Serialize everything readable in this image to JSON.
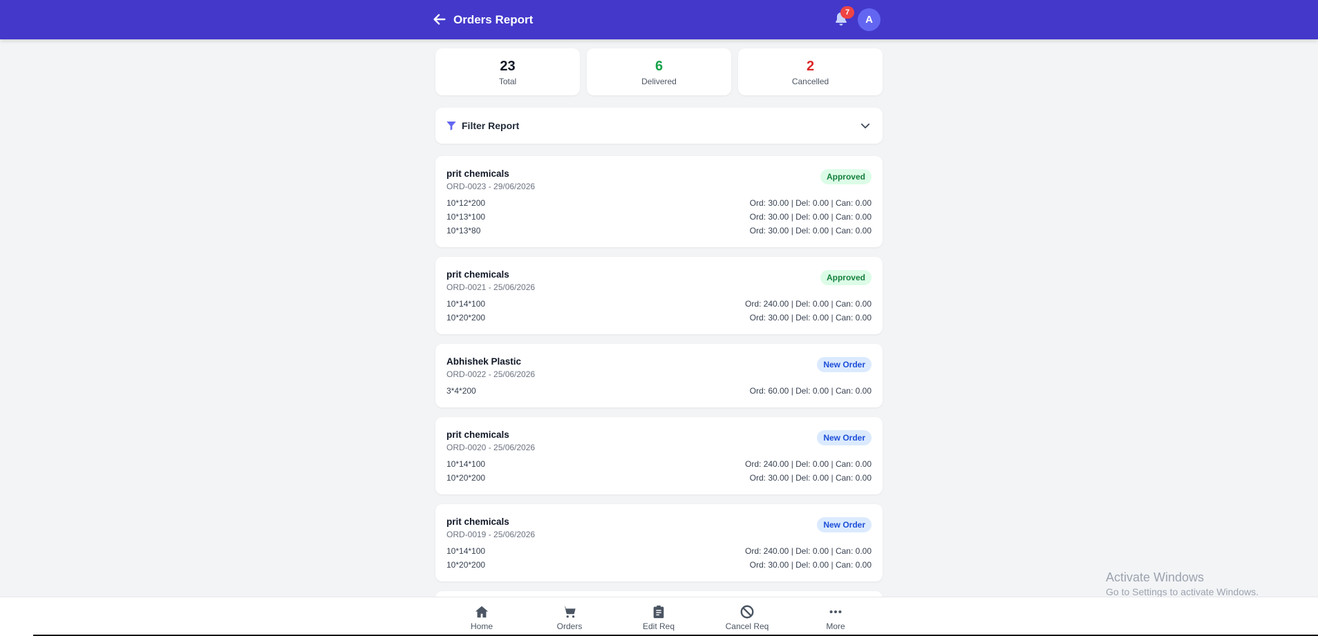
{
  "header": {
    "title": "Orders Report",
    "notification_count": "7",
    "avatar_initial": "A"
  },
  "stats": [
    {
      "value": "23",
      "label": "Total",
      "color": "#111827"
    },
    {
      "value": "6",
      "label": "Delivered",
      "color": "#16a34a"
    },
    {
      "value": "2",
      "label": "Cancelled",
      "color": "#dc2626"
    }
  ],
  "filter": {
    "label": "Filter Report"
  },
  "orders": [
    {
      "customer": "prit chemicals",
      "meta": "ORD-0023 - 29/06/2026",
      "status": "Approved",
      "items": [
        {
          "name": "10*12*200",
          "qty": "Ord: 30.00 | Del: 0.00 | Can: 0.00"
        },
        {
          "name": "10*13*100",
          "qty": "Ord: 30.00 | Del: 0.00 | Can: 0.00"
        },
        {
          "name": "10*13*80",
          "qty": "Ord: 30.00 | Del: 0.00 | Can: 0.00"
        }
      ]
    },
    {
      "customer": "prit chemicals",
      "meta": "ORD-0021 - 25/06/2026",
      "status": "Approved",
      "items": [
        {
          "name": "10*14*100",
          "qty": "Ord: 240.00 | Del: 0.00 | Can: 0.00"
        },
        {
          "name": "10*20*200",
          "qty": "Ord: 30.00 | Del: 0.00 | Can: 0.00"
        }
      ]
    },
    {
      "customer": "Abhishek Plastic",
      "meta": "ORD-0022 - 25/06/2026",
      "status": "New Order",
      "items": [
        {
          "name": "3*4*200",
          "qty": "Ord: 60.00 | Del: 0.00 | Can: 0.00"
        }
      ]
    },
    {
      "customer": "prit chemicals",
      "meta": "ORD-0020 - 25/06/2026",
      "status": "New Order",
      "items": [
        {
          "name": "10*14*100",
          "qty": "Ord: 240.00 | Del: 0.00 | Can: 0.00"
        },
        {
          "name": "10*20*200",
          "qty": "Ord: 30.00 | Del: 0.00 | Can: 0.00"
        }
      ]
    },
    {
      "customer": "prit chemicals",
      "meta": "ORD-0019 - 25/06/2026",
      "status": "New Order",
      "items": [
        {
          "name": "10*14*100",
          "qty": "Ord: 240.00 | Del: 0.00 | Can: 0.00"
        },
        {
          "name": "10*20*200",
          "qty": "Ord: 30.00 | Del: 0.00 | Can: 0.00"
        }
      ]
    }
  ],
  "nav": [
    {
      "label": "Home",
      "icon": "home-icon"
    },
    {
      "label": "Orders",
      "icon": "cart-icon"
    },
    {
      "label": "Edit Req",
      "icon": "clipboard-icon"
    },
    {
      "label": "Cancel Req",
      "icon": "ban-icon"
    },
    {
      "label": "More",
      "icon": "more-icon"
    }
  ],
  "watermark": {
    "line1": "Activate Windows",
    "line2": "Go to Settings to activate Windows."
  }
}
